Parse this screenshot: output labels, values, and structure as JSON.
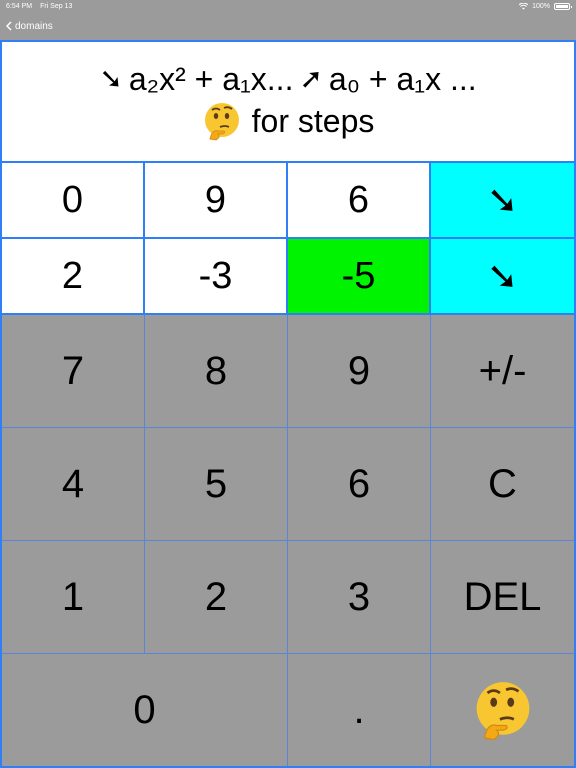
{
  "status_bar": {
    "time": "6:54 PM",
    "date": "Fri Sep 13",
    "battery": "100%",
    "battery_level": 1.0
  },
  "nav": {
    "back_label": "domains"
  },
  "header": {
    "formula_left_arrow": "➘",
    "formula_left": "a₂x² + a₁x...",
    "formula_right_arrow": "➚",
    "formula_right": "a₀ + a₁x ...",
    "steps_label": "for steps",
    "steps_icon": "thinking-face-icon"
  },
  "coefficients": {
    "rows": [
      [
        "0",
        "9",
        "6"
      ],
      [
        "2",
        "-3",
        "-5"
      ]
    ],
    "direction_labels": [
      "➘",
      "➘"
    ],
    "selected": {
      "row": 1,
      "col": 2
    },
    "selected_color": "#00f300",
    "direction_color": "#00ffff"
  },
  "keypad": {
    "row1": [
      "7",
      "8",
      "9",
      "+/-"
    ],
    "row2": [
      "4",
      "5",
      "6",
      "C"
    ],
    "row3": [
      "1",
      "2",
      "3",
      "DEL"
    ],
    "row4": [
      "0",
      ".",
      ""
    ],
    "help_icon": "thinking-face-icon"
  },
  "colors": {
    "accent": "#2f7ff7",
    "keypad_bg": "#9b9b9b"
  }
}
